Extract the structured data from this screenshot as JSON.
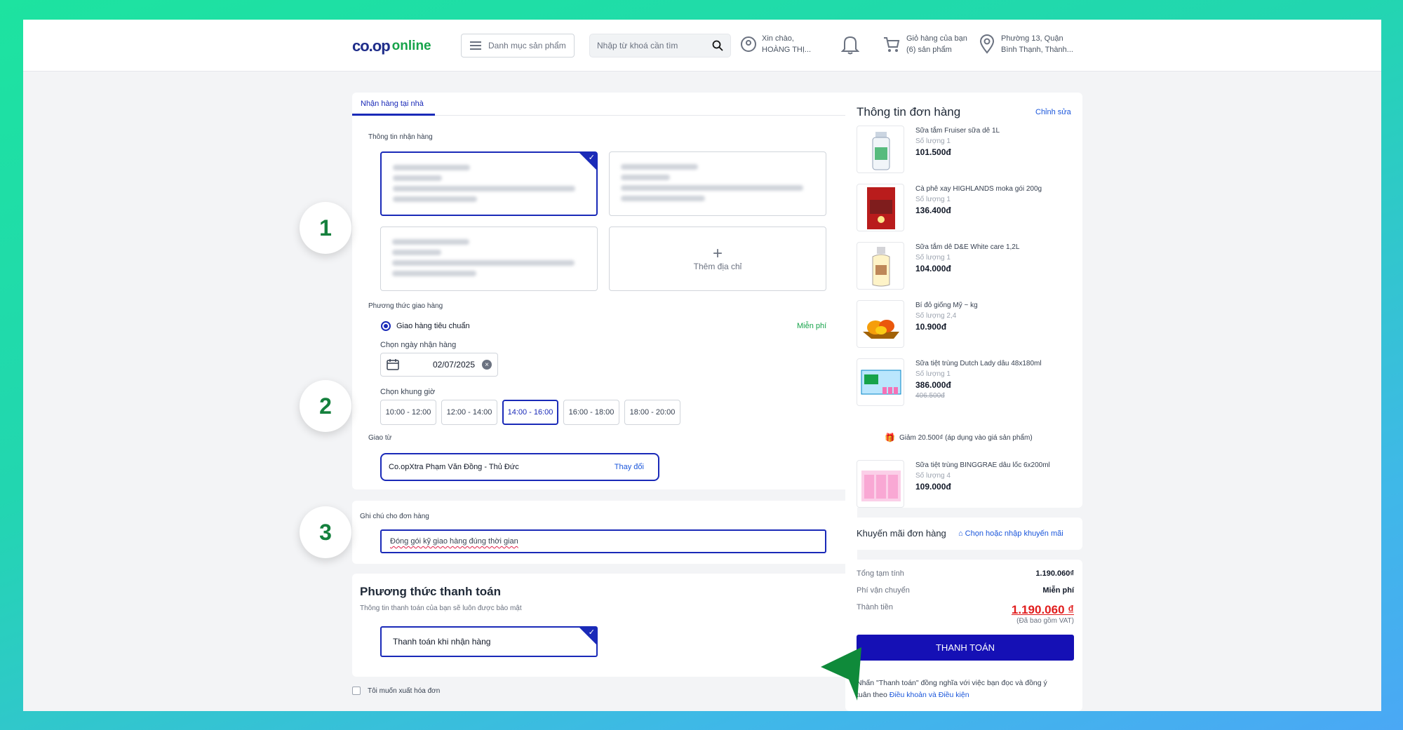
{
  "header": {
    "logo_prefix": "co.op",
    "logo_suffix": "online",
    "category_button": "Danh mục sản phẩm",
    "search_placeholder": "Nhập từ khoá cần tìm",
    "greeting_line1": "Xin chào,",
    "greeting_line2": "HOÀNG THỊ...",
    "cart_line1": "Giỏ hàng của bạn",
    "cart_line2": "(6) sản phẩm",
    "location_line1": "Phường 13, Quận",
    "location_line2": "Bình Thạnh, Thành..."
  },
  "delivery": {
    "tab_label": "Nhận hàng tại nhà",
    "receiver_info_label": "Thông tin nhận hàng",
    "add_address_label": "Thêm địa chỉ",
    "shipping_method_label": "Phương thức giao hàng",
    "standard_shipping": "Giao hàng tiêu chuẩn",
    "free_label": "Miễn phí",
    "pick_date_label": "Chọn ngày nhận hàng",
    "date_value": "02/07/2025",
    "pick_slot_label": "Chọn khung giờ",
    "time_slots": [
      "10:00 - 12:00",
      "12:00 - 14:00",
      "14:00 - 16:00",
      "16:00 - 18:00",
      "18:00 - 20:00"
    ],
    "selected_slot_index": 2,
    "ship_from_label": "Giao từ",
    "store_name": "Co.opXtra Phạm Văn Đồng - Thủ Đức",
    "change_label": "Thay đổi"
  },
  "note": {
    "label": "Ghi chú cho đơn hàng",
    "value": "Đóng gói kỹ giao hàng đúng thời gian"
  },
  "payment": {
    "title": "Phương thức thanh toán",
    "subtitle": "Thông tin thanh toán của bạn sẽ luôn được bảo mật",
    "option": "Thanh toán khi nhận hàng",
    "invoice_label": "Tôi muốn xuất hóa đơn"
  },
  "steps": [
    "1",
    "2",
    "3"
  ],
  "order": {
    "title": "Thông tin đơn hàng",
    "edit_label": "Chỉnh sửa",
    "items": [
      {
        "name": "Sữa tắm Fruiser sữa dê 1L",
        "qty": "Số lượng 1",
        "price": "101.500đ"
      },
      {
        "name": "Cà phê xay HIGHLANDS moka gói 200g",
        "qty": "Số lượng 1",
        "price": "136.400đ"
      },
      {
        "name": "Sữa tắm dê D&E White care 1,2L",
        "qty": "Số lượng 1",
        "price": "104.000đ"
      },
      {
        "name": "Bí đỏ giống Mỹ ~ kg",
        "qty": "Số lượng 2,4",
        "price": "10.900đ"
      },
      {
        "name": "Sữa tiệt trùng Dutch Lady dâu 48x180ml",
        "qty": "Số lượng 1",
        "price": "386.000đ",
        "old_price": "406.500đ"
      },
      {
        "name": "Sữa tiệt trùng BINGGRAE dâu lốc 6x200ml",
        "qty": "Số lượng 4",
        "price": "109.000đ"
      }
    ],
    "discount_note": "Giảm 20.500₫ (áp dụng vào giá sản phẩm)"
  },
  "promo": {
    "title": "Khuyến mãi đơn hàng",
    "link": "Chọn hoặc nhập khuyến mãi"
  },
  "summary": {
    "subtotal_label": "Tổng tạm tính",
    "subtotal_value": "1.190.060₫",
    "shipping_label": "Phí vận chuyển",
    "shipping_value": "Miễn phí",
    "total_label": "Thành tiền",
    "total_value": "1.190.060 ₫",
    "vat_note": "(Đã bao gồm VAT)",
    "pay_button": "THANH TOÁN",
    "terms_prefix": "Nhấn \"Thanh toán\" đồng nghĩa với việc bạn đọc và đồng ý",
    "terms_prefix2": "tuân theo",
    "terms_link": "Điều khoản và Điều kiện"
  },
  "colors": {
    "accent": "#1a2ab8",
    "pay_button": "#1510b5",
    "total": "#e11d1d",
    "free": "#16a34a",
    "step": "#15803d"
  }
}
